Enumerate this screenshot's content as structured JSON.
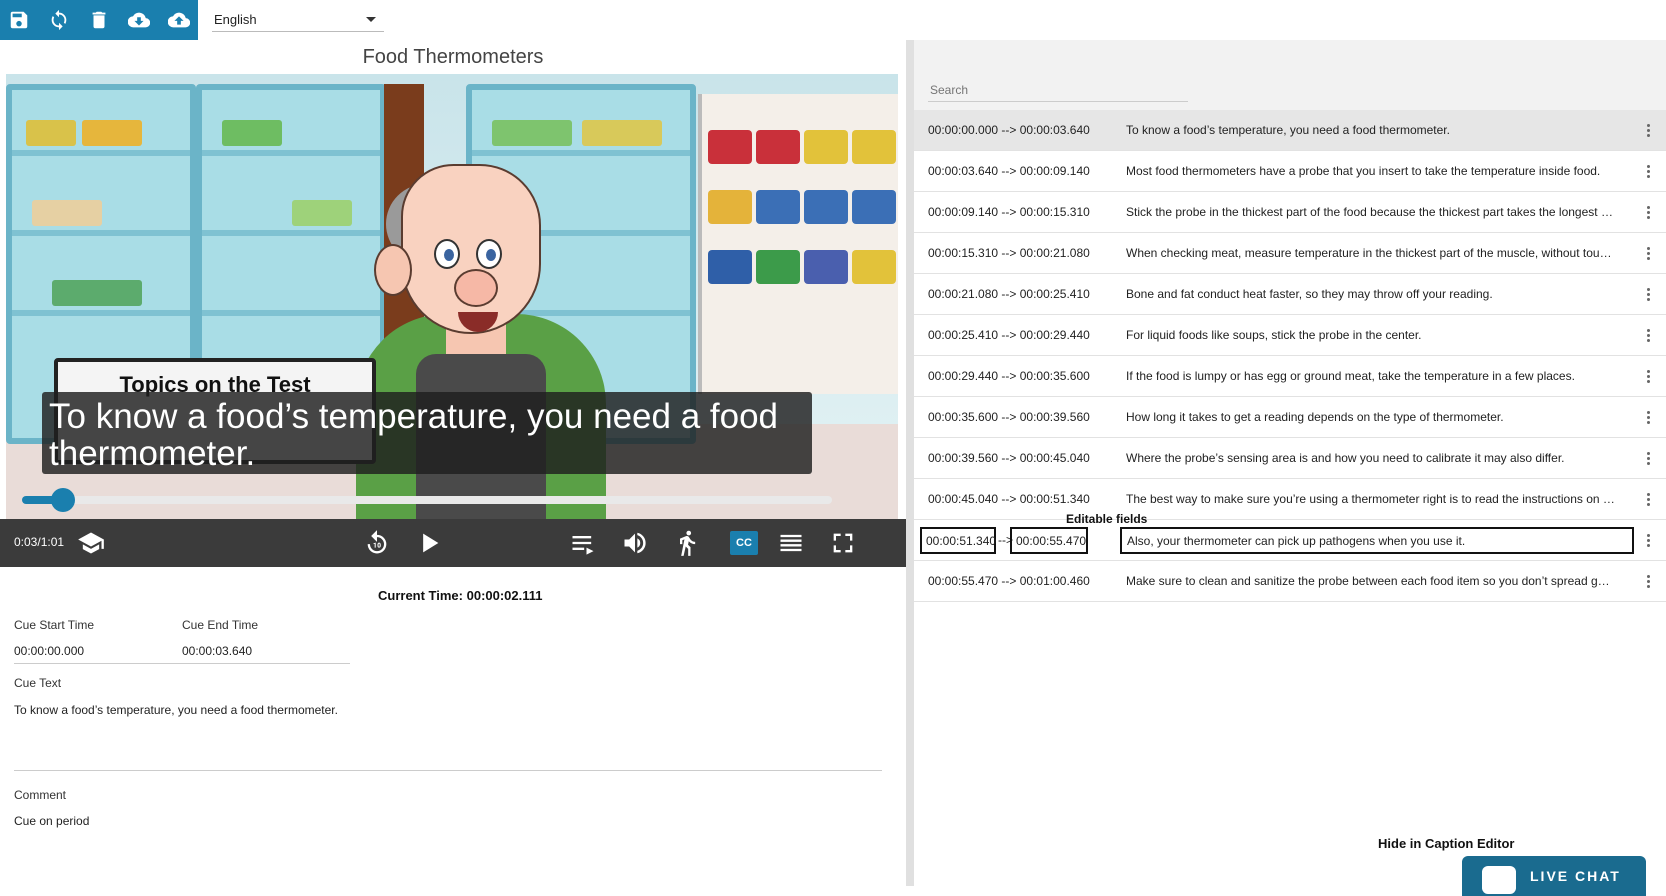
{
  "toolbar": {
    "buttons": [
      {
        "name": "save",
        "icon": "save-icon"
      },
      {
        "name": "refresh",
        "icon": "refresh-icon"
      },
      {
        "name": "delete",
        "icon": "trash-icon"
      },
      {
        "name": "download",
        "icon": "cloud-download-icon"
      },
      {
        "name": "upload",
        "icon": "cloud-upload-icon"
      }
    ],
    "accent": "#1a7fae"
  },
  "language": {
    "selected": "English"
  },
  "video": {
    "title": "Food Thermometers",
    "on_screen_card": "Topics on the Test",
    "caption": "To know a food’s temperature, you need a food thermometer.",
    "progress_fraction": 0.05,
    "time": "0:03/1:01"
  },
  "controls": {
    "cc_label": "CC",
    "icons": [
      "graduation-cap-icon",
      "rewind-10-icon",
      "play-icon",
      "playlist-icon",
      "volume-icon",
      "running-icon",
      "cc-icon",
      "transcript-icon",
      "fullscreen-icon"
    ]
  },
  "cue_editor": {
    "start_label": "Cue Start Time",
    "start_value": "00:00:00.000",
    "end_label": "Cue End Time",
    "end_value": "00:00:03.640",
    "current_time": "Current Time: 00:00:02.111",
    "text_label": "Cue Text",
    "text_value": "To know a food’s temperature, you need a food thermometer.",
    "comment_label": "Comment",
    "comment_value": "Cue on period"
  },
  "search": {
    "placeholder": "Search"
  },
  "cues": [
    {
      "time": "00:00:00.000 --> 00:00:03.640",
      "text": "To know a food’s temperature, you need a food thermometer."
    },
    {
      "time": "00:00:03.640 --> 00:00:09.140",
      "text": "Most food thermometers have a probe that you insert to take the temperature inside food."
    },
    {
      "time": "00:00:09.140 --> 00:00:15.310",
      "text": "Stick the probe in the thickest part of the food because the thickest part takes the longest to cook."
    },
    {
      "time": "00:00:15.310 --> 00:00:21.080",
      "text": "When checking meat, measure temperature in the thickest part of the muscle, without touching bone."
    },
    {
      "time": "00:00:21.080 --> 00:00:25.410",
      "text": "Bone and fat conduct heat faster, so they may throw off your reading."
    },
    {
      "time": "00:00:25.410 --> 00:00:29.440",
      "text": "For liquid foods like soups, stick the probe in the center."
    },
    {
      "time": "00:00:29.440 --> 00:00:35.600",
      "text": "If the food is lumpy or has egg or ground meat, take the temperature in a few places."
    },
    {
      "time": "00:00:35.600 --> 00:00:39.560",
      "text": "How long it takes to get a reading depends on the type of thermometer."
    },
    {
      "time": "00:00:39.560 --> 00:00:45.040",
      "text": "Where the probe’s sensing area is and how you need to calibrate it may also differ."
    },
    {
      "time": "00:00:45.040 --> 00:00:51.340",
      "text": "The best way to make sure you’re using a thermometer right is to read the instructions on the package."
    }
  ],
  "editing_cue": {
    "start": "00:00:51.340",
    "arrow": "-->",
    "end": "00:00:55.470",
    "text": "Also, your thermometer can pick up pathogens when you use it."
  },
  "last_cue": {
    "time": "00:00:55.470 --> 00:01:00.460",
    "text": "Make sure to clean and sanitize the probe between each food item so you don’t spread germs."
  },
  "annotations": {
    "editable_fields": "Editable fields",
    "hide_in_caption_editor": "Hide in Caption Editor"
  },
  "live_chat": {
    "label": "LIVE CHAT"
  }
}
